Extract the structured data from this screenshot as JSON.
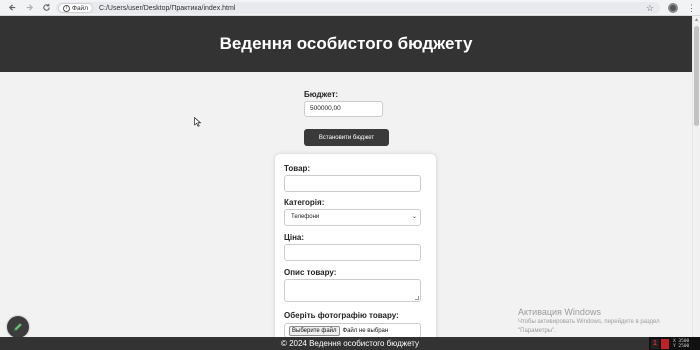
{
  "browser": {
    "address_chip": "Файл",
    "url": "C:/Users/user/Desktop/Практика/index.html",
    "icons": [
      "back-icon",
      "forward-icon",
      "reload-icon",
      "info-icon",
      "star-icon",
      "profile-icon",
      "more-icon"
    ]
  },
  "header": {
    "title": "Ведення особистого бюджету"
  },
  "budget": {
    "label": "Бюджет:",
    "value": "500000,00",
    "button": "Встановити бюджет"
  },
  "form": {
    "product_label": "Товар:",
    "category_label": "Категорія:",
    "category_selected": "Телефони",
    "price_label": "Ціна:",
    "description_label": "Опис товару:",
    "photo_label": "Оберіть фотографію товару:",
    "file_button": "Выберите файл",
    "file_status": "Файл не выбран"
  },
  "footer": {
    "text": "© 2024 Ведення особистого бюджету"
  },
  "watermark": {
    "title": "Активация Windows",
    "line1": "Чтобы активировать Windows, перейдите в раздел",
    "line2": "\"Параметры\"."
  },
  "tray": {
    "x": "X 3500",
    "y": "Y 2500"
  },
  "colors": {
    "header_bg": "#333333",
    "page_bg": "#f2f2f2",
    "button_bg": "#3a3a3a"
  }
}
